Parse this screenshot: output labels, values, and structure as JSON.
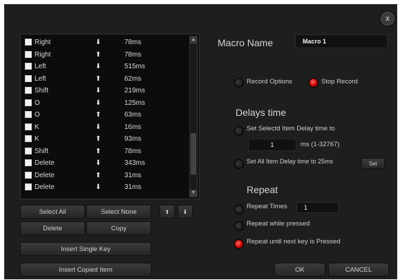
{
  "dialog": {
    "close_label": "x"
  },
  "list": {
    "rows": [
      {
        "key": "Right",
        "arrow": "⬇",
        "time": "78ms"
      },
      {
        "key": "Right",
        "arrow": "⬆",
        "time": "78ms"
      },
      {
        "key": "Left",
        "arrow": "⬇",
        "time": "515ms"
      },
      {
        "key": "Left",
        "arrow": "⬆",
        "time": "62ms"
      },
      {
        "key": "Shift",
        "arrow": "⬇",
        "time": "219ms"
      },
      {
        "key": "O",
        "arrow": "⬇",
        "time": "125ms"
      },
      {
        "key": "O",
        "arrow": "⬆",
        "time": "63ms"
      },
      {
        "key": "K",
        "arrow": "⬇",
        "time": "16ms"
      },
      {
        "key": "K",
        "arrow": "⬆",
        "time": "93ms"
      },
      {
        "key": "Shift",
        "arrow": "⬆",
        "time": "78ms"
      },
      {
        "key": "Delete",
        "arrow": "⬇",
        "time": "343ms"
      },
      {
        "key": "Delete",
        "arrow": "⬆",
        "time": "31ms"
      },
      {
        "key": "Delete",
        "arrow": "⬇",
        "time": "31ms"
      }
    ],
    "scroll_up": "▲",
    "scroll_down": "▼"
  },
  "buttons": {
    "select_all": "Select All",
    "select_none": "Select None",
    "move_up": "⬆",
    "move_down": "⬇",
    "delete": "Delete",
    "copy": "Copy",
    "insert_single": "Insert Single Key",
    "insert_copied": "Insert Copied Item",
    "ok": "OK",
    "cancel": "CANCEL",
    "set": "Set"
  },
  "macro": {
    "name_label": "Macro Name",
    "name_value": "Macro 1"
  },
  "record": {
    "options_label": "Record Options",
    "stop_label": "Stop Record"
  },
  "delays": {
    "title": "Delays time",
    "selected_label": "Set Selectd Item Delay time to",
    "selected_value": "1",
    "selected_unit": "ms (1-32767)",
    "all_label": "Set All Item Delay time to 25ms"
  },
  "repeat": {
    "title": "Repeat",
    "times_label": "Repeat Times",
    "times_value": "1",
    "while_label": "Repeat while pressed",
    "until_label": "Repeat until next key is Pressed"
  }
}
